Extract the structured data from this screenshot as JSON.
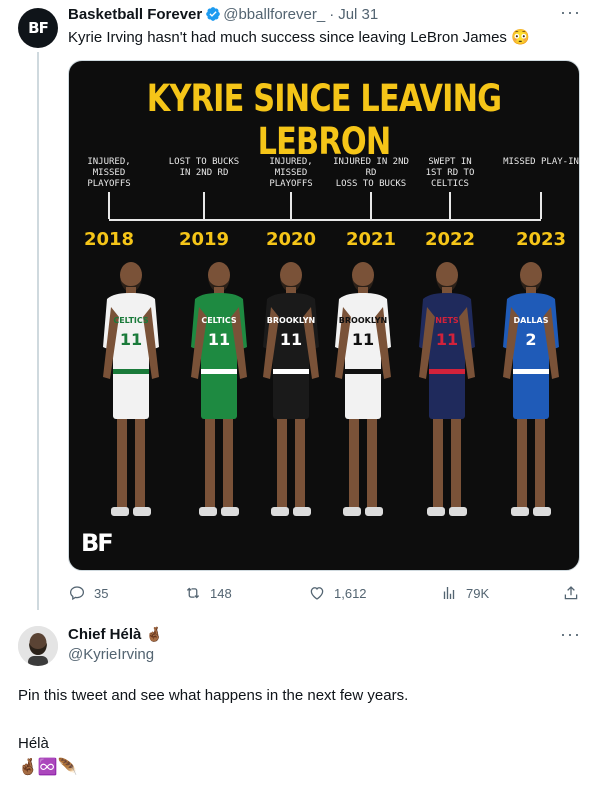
{
  "tweet": {
    "avatar_text": "BF",
    "author_name": "Basketball Forever",
    "handle": "@bballforever_",
    "separator": "·",
    "date": "Jul 31",
    "text": "Kyrie Irving hasn't had much success since leaving LeBron James",
    "text_emoji": "😳",
    "more_label": "···",
    "image": {
      "title": "KYRIE SINCE LEAVING LEBRON",
      "timeline": [
        {
          "label_line1": "INJURED,",
          "label_line2": "MISSED PLAYOFFS",
          "year": "2018",
          "jersey_team": "CELTICS",
          "jersey_number": "11",
          "jersey_color": "#f2f2f2",
          "trim_color": "#1a7a3a"
        },
        {
          "label_line1": "LOST TO BUCKS",
          "label_line2": "IN 2ND RD",
          "year": "2019",
          "jersey_team": "CELTICS",
          "jersey_number": "11",
          "jersey_color": "#1e8a41",
          "trim_color": "#ffffff"
        },
        {
          "label_line1": "INJURED,",
          "label_line2": "MISSED PLAYOFFS",
          "year": "2020",
          "jersey_team": "BROOKLYN",
          "jersey_number": "11",
          "jersey_color": "#1a1a1a",
          "trim_color": "#ffffff"
        },
        {
          "label_line1": "INJURED IN 2ND RD",
          "label_line2": "LOSS TO BUCKS",
          "year": "2021",
          "jersey_team": "BROOKLYN",
          "jersey_number": "11",
          "jersey_color": "#f2f2f2",
          "trim_color": "#111111"
        },
        {
          "label_line1": "SWEPT IN",
          "label_line2": "1ST RD TO CELTICS",
          "year": "2022",
          "jersey_team": "NETS",
          "jersey_number": "11",
          "jersey_color": "#1f2a5c",
          "trim_color": "#d2223b"
        },
        {
          "label_line1": "MISSED PLAY-IN",
          "label_line2": "",
          "year": "2023",
          "jersey_team": "DALLAS",
          "jersey_number": "2",
          "jersey_color": "#1f5bb8",
          "trim_color": "#ffffff"
        }
      ],
      "watermark": "BF"
    },
    "actions": {
      "replies": "35",
      "retweets": "148",
      "likes": "1,612",
      "views": "79K"
    }
  },
  "reply": {
    "author_name": "Chief Hélà",
    "author_emoji": "🤞🏾",
    "handle": "@KyrieIrving",
    "more_label": "···",
    "text_line1": "Pin this tweet and see what happens in the next few years.",
    "text_line2": "Hélà",
    "text_line3": "🤞🏾♾️🪶"
  },
  "colors": {
    "accent": "#1d9bf0",
    "title_yellow": "#f5c518",
    "muted": "#536471"
  }
}
